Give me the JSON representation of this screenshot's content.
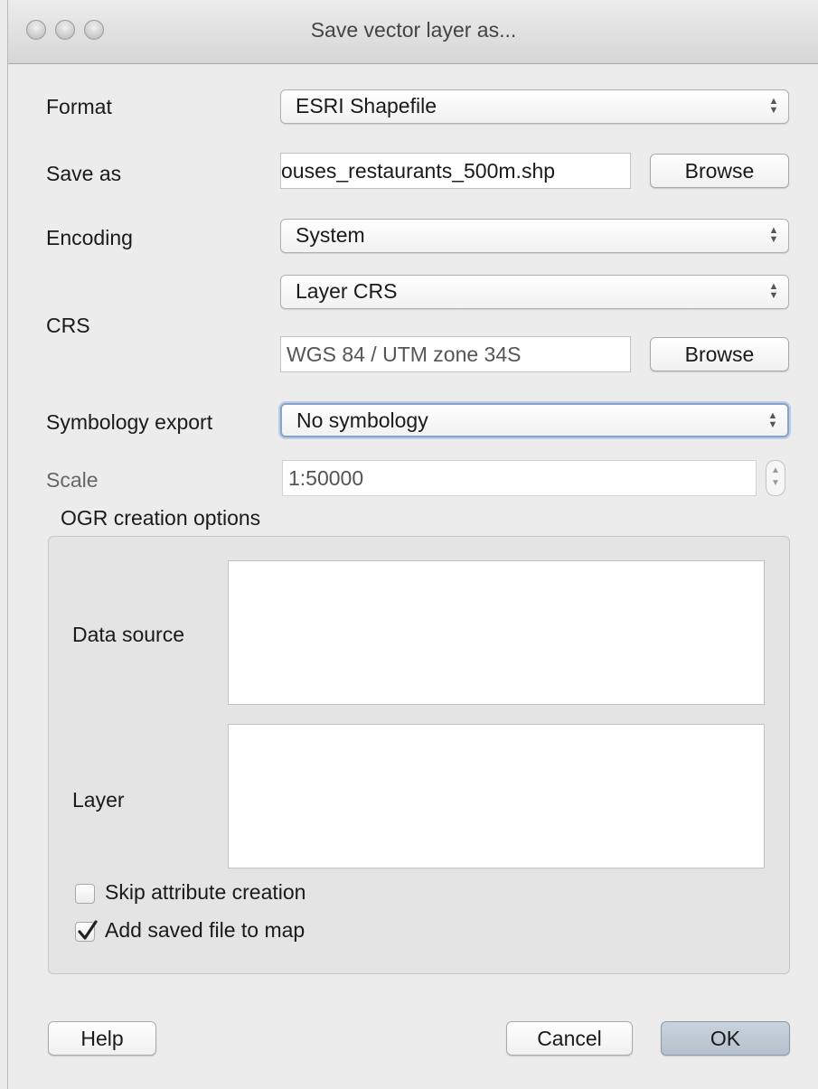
{
  "window": {
    "title": "Save vector layer as..."
  },
  "form": {
    "format_label": "Format",
    "format_value": "ESRI Shapefile",
    "save_as_label": "Save as",
    "save_as_value": "ouses_restaurants_500m.shp",
    "save_as_browse": "Browse",
    "encoding_label": "Encoding",
    "encoding_value": "System",
    "crs_label": "CRS",
    "crs_select_value": "Layer CRS",
    "crs_field_value": "WGS 84 / UTM zone 34S",
    "crs_browse": "Browse",
    "symbology_label": "Symbology export",
    "symbology_value": "No symbology",
    "scale_label": "Scale",
    "scale_value": "1:50000"
  },
  "ogr": {
    "title": "OGR creation options",
    "data_source_label": "Data source",
    "layer_label": "Layer",
    "data_source_value": "",
    "layer_value": ""
  },
  "options": {
    "skip_attribute_label": "Skip attribute creation",
    "skip_attribute_checked": false,
    "add_to_map_label": "Add saved file to map",
    "add_to_map_checked": true
  },
  "buttons": {
    "help": "Help",
    "cancel": "Cancel",
    "ok": "OK"
  }
}
